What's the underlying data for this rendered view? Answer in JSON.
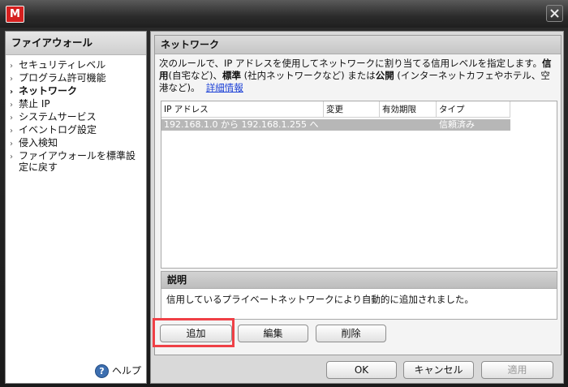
{
  "window": {
    "logo_letter": "M"
  },
  "sidebar": {
    "title": "ファイアウォール",
    "items": [
      {
        "label": "セキュリティレベル"
      },
      {
        "label": "プログラム許可機能"
      },
      {
        "label": "ネットワーク",
        "active": true
      },
      {
        "label": "禁止 IP"
      },
      {
        "label": "システムサービス"
      },
      {
        "label": "イベントログ設定"
      },
      {
        "label": "侵入検知"
      },
      {
        "label": "ファイアウォールを標準設定に戻す"
      }
    ],
    "help_label": "ヘルプ"
  },
  "panel": {
    "title": "ネットワーク",
    "description": {
      "part1": "次のルールで、IP アドレスを使用してネットワークに割り当てる信用レベルを指定します。",
      "trusted": "信用",
      "part2": "(自宅など)、",
      "standard": "標準",
      "part3": " (社内ネットワークなど) または",
      "public": "公開",
      "part4": " (インターネットカフェやホテル、空港など)。",
      "link": "詳細情報"
    },
    "table": {
      "columns": [
        "IP アドレス",
        "変更",
        "有効期限",
        "タイプ"
      ],
      "rows": [
        {
          "ip": "192.168.1.0 から 192.168.1.255 へ",
          "changed": "",
          "expires": "",
          "type": "信頼済み"
        }
      ]
    },
    "explanation": {
      "title": "説明",
      "text": "信用しているプライベートネットワークにより自動的に追加されました。"
    },
    "buttons": {
      "add": "追加",
      "edit": "編集",
      "delete": "削除"
    }
  },
  "footer": {
    "ok": "OK",
    "cancel": "キャンセル",
    "apply": "適用"
  }
}
